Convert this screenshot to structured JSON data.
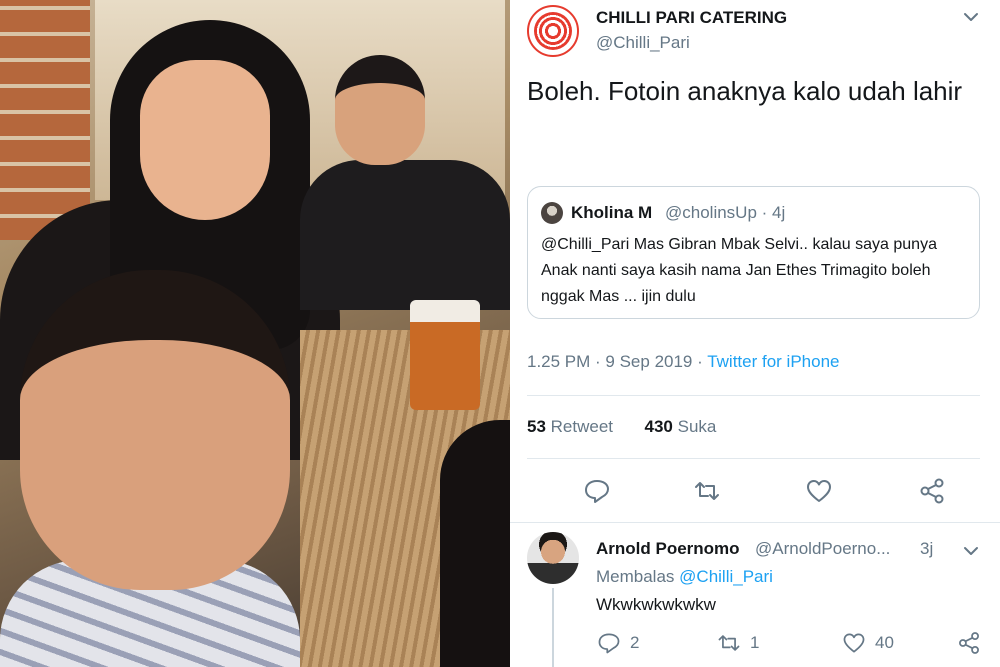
{
  "tweet": {
    "author_name": "CHILLI PARI CATERING",
    "author_handle": "@Chilli_Pari",
    "text": "Boleh. Fotoin anaknya kalo udah lahir",
    "timestamp": "1.25 PM · 9 Sep 2019",
    "source": "Twitter for iPhone",
    "retweet_count": "53",
    "retweet_label": "Retweet",
    "like_count": "430",
    "like_label": "Suka"
  },
  "quoted_tweet": {
    "author_name": "Kholina M",
    "author_handle": "@cholinsUp · 4j",
    "text": "@Chilli_Pari Mas Gibran Mbak Selvi.. kalau saya punya Anak nanti saya kasih nama Jan Ethes Trimagito boleh nggak Mas ... ijin dulu"
  },
  "reply": {
    "author_name": "Arnold Poernomo",
    "author_handle": "@ArnoldPoerno...",
    "time": "3j",
    "replying_prefix": "Membalas",
    "replying_to": "@Chilli_Pari",
    "text": "Wkwkwkwkwkw",
    "reply_count": "2",
    "retweet_count": "1",
    "like_count": "40"
  },
  "icons": {
    "reply": "reply-icon",
    "retweet": "retweet-icon",
    "like": "heart-icon",
    "share": "share-icon",
    "menu": "chevron-down-icon"
  },
  "colors": {
    "link": "#1da1f2",
    "secondary_text": "#657786",
    "primary_text": "#14171a",
    "brand_red": "#e63b2e"
  }
}
